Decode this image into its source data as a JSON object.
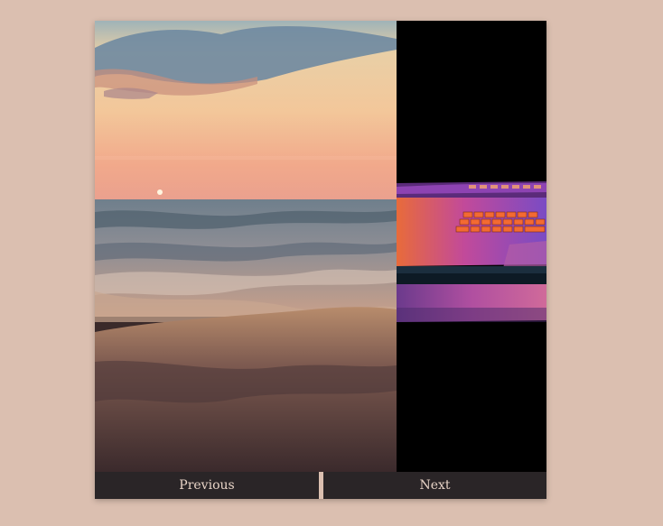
{
  "carousel": {
    "previous_label": "Previous",
    "next_label": "Next",
    "slides": [
      {
        "subject": "beach-sunset-image"
      },
      {
        "subject": "laptop-keyboard-image"
      }
    ]
  },
  "colors": {
    "page_background": "#dbbfb0",
    "button_background": "#2a2527",
    "button_text": "#e7d3c6"
  }
}
